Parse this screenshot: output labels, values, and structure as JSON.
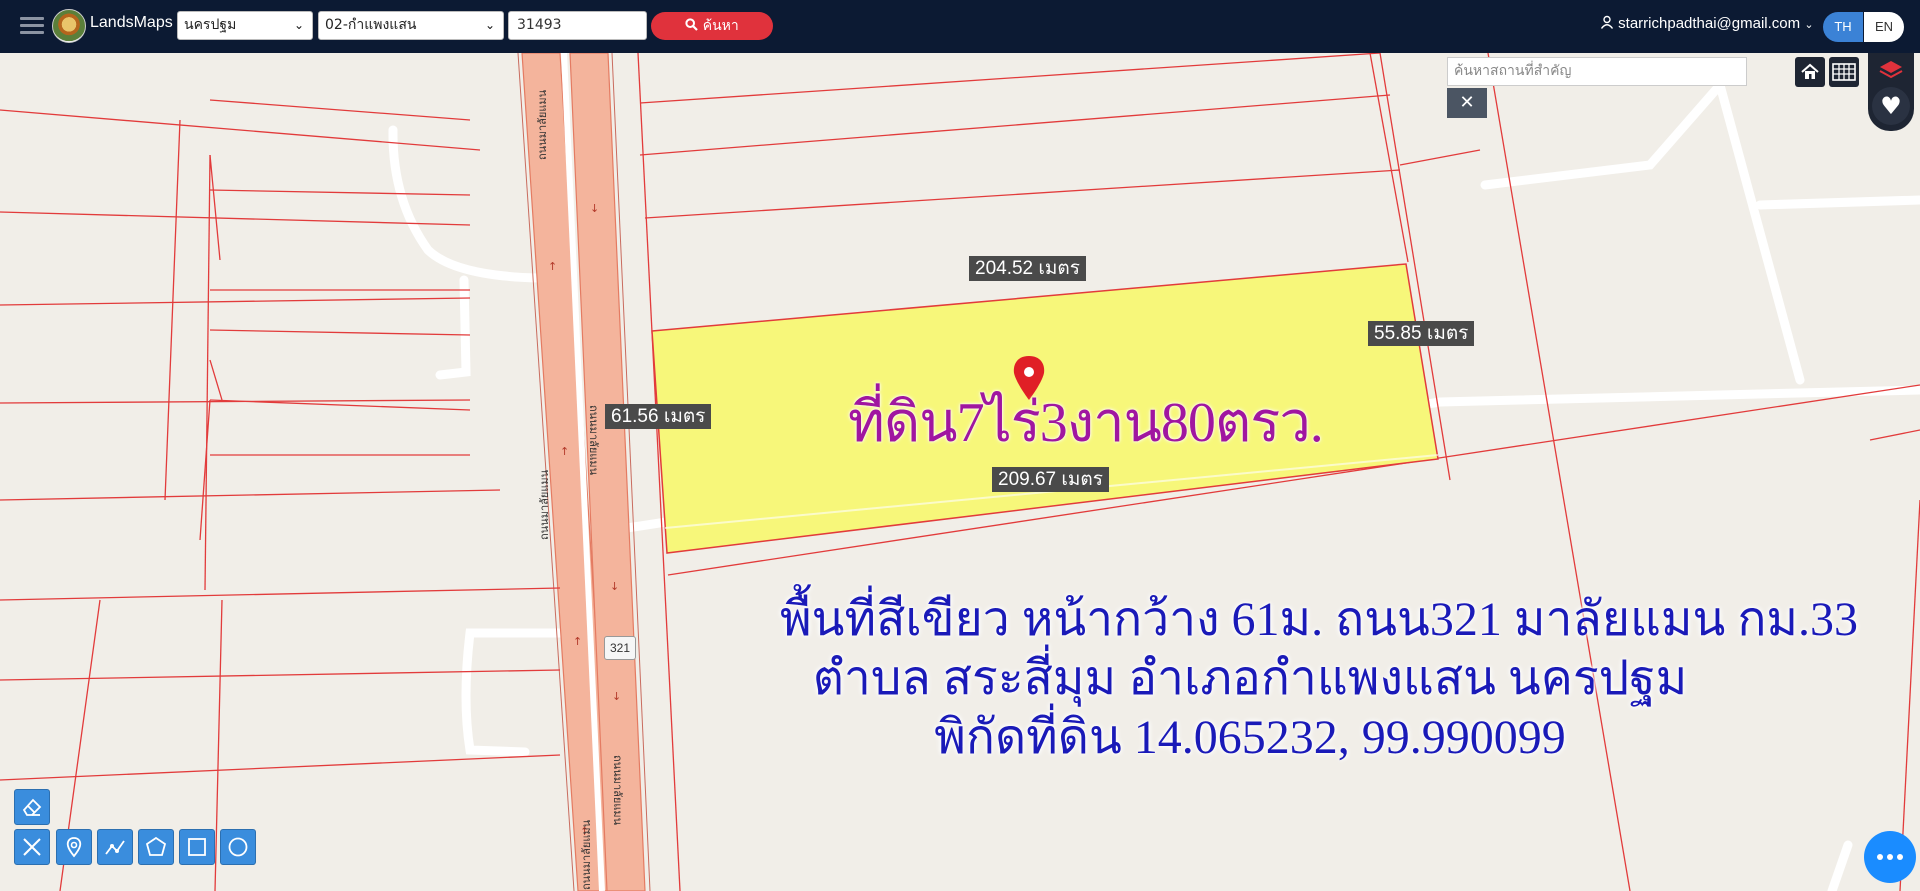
{
  "app": {
    "brand": "LandsMaps"
  },
  "search": {
    "province": "นครปฐม",
    "district": "02-กำแพงแสน",
    "parcel_number": "31493",
    "button_label": "ค้นหา",
    "place_placeholder": "ค้นหาสถานที่สำคัญ",
    "close_label": "✕"
  },
  "user": {
    "email": "starrichpadthai@gmail.com"
  },
  "language": {
    "th": "TH",
    "en": "EN"
  },
  "measurements": {
    "top": "204.52 เมตร",
    "right": "55.85 เมตร",
    "left": "61.56 เมตร",
    "bottom": "209.67 เมตร"
  },
  "overlay": {
    "title": "ที่ดิน7ไร่3งาน80ตรว.",
    "line1": "พื้นที่สีเขียว หน้ากว้าง 61ม. ถนน321 มาลัยแมน กม.33",
    "line2": "ตำบล สระสี่มุม อำเภอกำแพงแสน นครปฐม",
    "line3": "พิกัดที่ดิน 14.065232, 99.990099"
  },
  "road": {
    "shield": "321",
    "name": "ถนนมาลัยแมน"
  },
  "colors": {
    "topbar": "#0c1a33",
    "search_button": "#e0323c",
    "parcel_fill": "#f7f77a",
    "title": "#a016a0",
    "description": "#1a1ab8"
  }
}
